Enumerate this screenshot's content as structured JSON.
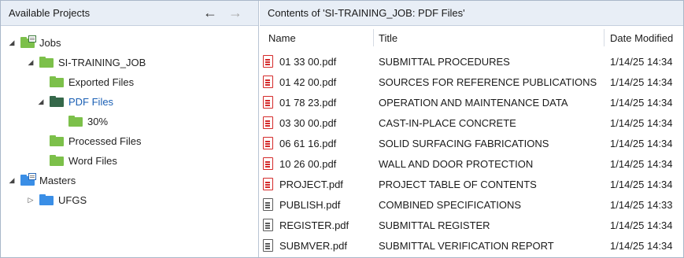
{
  "left_panel": {
    "title": "Available Projects",
    "back_glyph": "←",
    "forward_glyph": "→",
    "tree": [
      {
        "label": "Jobs",
        "expand": "◢",
        "icon": "green-folder-with-overlay-icon"
      },
      {
        "label": "SI-TRAINING_JOB",
        "expand": "◢",
        "icon": "green-folder-icon"
      },
      {
        "label": "Exported Files",
        "expand": "",
        "icon": "green-folder-icon"
      },
      {
        "label": "PDF Files",
        "expand": "◢",
        "icon": "dark-green-folder-icon",
        "selected": true
      },
      {
        "label": "30%",
        "expand": "",
        "icon": "green-folder-icon"
      },
      {
        "label": "Processed Files",
        "expand": "",
        "icon": "green-folder-icon"
      },
      {
        "label": "Word Files",
        "expand": "",
        "icon": "green-folder-icon"
      },
      {
        "label": "Masters",
        "expand": "◢",
        "icon": "blue-folder-with-overlay-icon"
      },
      {
        "label": "UFGS",
        "expand": "▷",
        "icon": "blue-folder-icon"
      }
    ]
  },
  "right_panel": {
    "title": "Contents of 'SI-TRAINING_JOB: PDF Files'",
    "columns": {
      "name": "Name",
      "title": "Title",
      "date": "Date Modified"
    },
    "files": [
      {
        "name": "01 33 00.pdf",
        "title": "SUBMITTAL PROCEDURES",
        "date": "1/14/25 14:34",
        "icon": "pdf-red-icon"
      },
      {
        "name": "01 42 00.pdf",
        "title": "SOURCES FOR REFERENCE PUBLICATIONS",
        "date": "1/14/25 14:34",
        "icon": "pdf-red-icon"
      },
      {
        "name": "01 78 23.pdf",
        "title": "OPERATION AND MAINTENANCE DATA",
        "date": "1/14/25 14:34",
        "icon": "pdf-red-icon"
      },
      {
        "name": "03 30 00.pdf",
        "title": "CAST-IN-PLACE CONCRETE",
        "date": "1/14/25 14:34",
        "icon": "pdf-red-icon"
      },
      {
        "name": "06 61 16.pdf",
        "title": "SOLID SURFACING FABRICATIONS",
        "date": "1/14/25 14:34",
        "icon": "pdf-red-icon"
      },
      {
        "name": "10 26 00.pdf",
        "title": "WALL AND DOOR PROTECTION",
        "date": "1/14/25 14:34",
        "icon": "pdf-red-icon"
      },
      {
        "name": "PROJECT.pdf",
        "title": "PROJECT TABLE OF CONTENTS",
        "date": "1/14/25 14:34",
        "icon": "pdf-red-icon"
      },
      {
        "name": "PUBLISH.pdf",
        "title": "COMBINED SPECIFICATIONS",
        "date": "1/14/25 14:33",
        "icon": "pdf-gray-icon"
      },
      {
        "name": "REGISTER.pdf",
        "title": "SUBMITTAL REGISTER",
        "date": "1/14/25 14:34",
        "icon": "pdf-gray-icon"
      },
      {
        "name": "SUBMVER.pdf",
        "title": "SUBMITTAL VERIFICATION REPORT",
        "date": "1/14/25 14:34",
        "icon": "pdf-gray-icon"
      }
    ]
  },
  "colors": {
    "header_bg": "#e8eef6",
    "selected_text": "#1a5fb4",
    "folder_green": "#7cc04a",
    "folder_dark_green": "#35684a",
    "folder_blue": "#3a8ee6",
    "pdf_red": "#d42a2a",
    "pdf_gray": "#5b5b5b"
  }
}
